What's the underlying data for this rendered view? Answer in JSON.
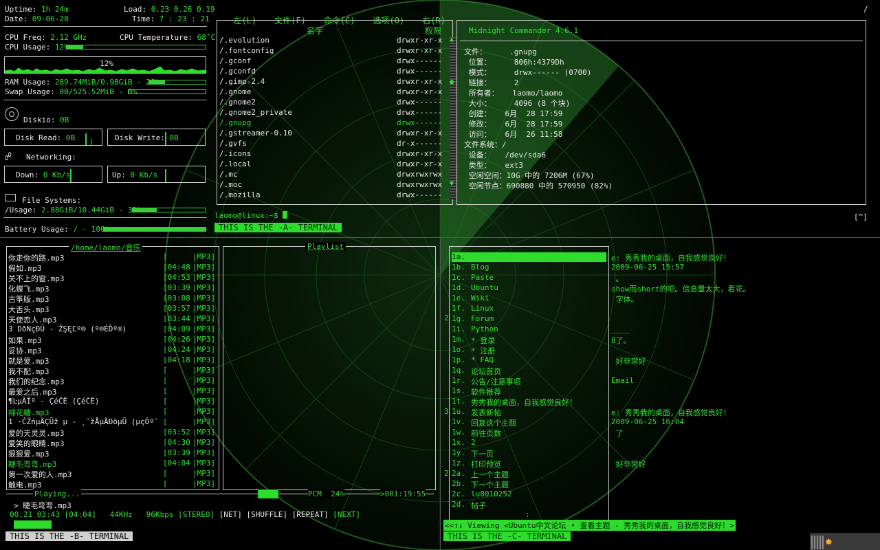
{
  "conky": {
    "uptime_label": "Uptime:",
    "uptime": "1h 24m",
    "load_label": "Load:",
    "load": "0.23 0.26 0.19",
    "date_label": "Date:",
    "date": "09-06-28",
    "time_label": "Time:",
    "time": "7 : 23 : 21",
    "cpu_freq_label": "CPU Freq:",
    "cpu_freq": "2.12 GHz",
    "cpu_temp_label": "CPU Temperature:",
    "cpu_temp": "68˚C",
    "cpu_usage_label": "CPU Usage:",
    "cpu_usage": "12%",
    "cpu_usage_value": 0.12,
    "cpu_graph_label": "12%",
    "ram_label": "RAM Usage:",
    "ram": "289.74MiB/0.98GiB - 28%",
    "ram_value": 0.28,
    "swap_label": "Swap Usage:",
    "swap": "0B/525.52MiB - 0%",
    "swap_value": 0.0,
    "diskio_label": "Diskio:",
    "diskio": "0B",
    "disk_read_label": "Disk Read:",
    "disk_read": "0B",
    "disk_write_label": "Disk Write:",
    "disk_write": "0B",
    "networking_label": "Networking:",
    "down_label": "Down:",
    "down": "0 Kb/s",
    "up_label": "Up:",
    "up": "0 Kb/s",
    "fs_label": "File Systems:",
    "usage_label": "/Usage:",
    "usage": "2.88GiB/10.44GiB - 33%",
    "usage_value": 0.33,
    "battery_label": "Battery Usage:",
    "battery": "/ - 100%",
    "battery_value": 1.0
  },
  "mc": {
    "menu": [
      "左(L)",
      "文件(F)",
      "命令(C)",
      "选项(O)",
      "右(R)"
    ],
    "path_indicator": "/",
    "left_header_name": "名字",
    "left_header_perm": "权限",
    "files": [
      {
        "name": "/.evolution",
        "perm": "drwxr-xr-x"
      },
      {
        "name": "/.fontconfig",
        "perm": "drwxr-xr-x"
      },
      {
        "name": "/.gconf",
        "perm": "drwx------"
      },
      {
        "name": "/.gconfd",
        "perm": "drwx------"
      },
      {
        "name": "/.gimp-2.4",
        "perm": "drwxr-xr-x"
      },
      {
        "name": "/.gnome",
        "perm": "drwxr-xr-x"
      },
      {
        "name": "/.gnome2",
        "perm": "drwx------"
      },
      {
        "name": "/.gnome2_private",
        "perm": "drwx------"
      },
      {
        "name": "/.gnupg",
        "perm": "drwx------"
      },
      {
        "name": "/.gstreamer-0.10",
        "perm": "drwxr-xr-x"
      },
      {
        "name": "/.gvfs",
        "perm": "dr-x------"
      },
      {
        "name": "/.icons",
        "perm": "drwxr-xr-x"
      },
      {
        "name": "/.local",
        "perm": "drwxr-xr-x"
      },
      {
        "name": "/.mc",
        "perm": "drwxrwxrwx"
      },
      {
        "name": "/.moc",
        "perm": "drwxrwxrwx"
      },
      {
        "name": "/.mozilla",
        "perm": "drwx------"
      }
    ],
    "info_title": "Midnight Commander 4.6.1",
    "info": [
      "文件：     .gnupg",
      " 位置：     806h:4379Dh",
      " 模式：     drwx------ (0700)",
      " 链接：     2",
      " 所有者：   laomo/laomo",
      " 大小：     4096 (8 个块)",
      " 创建：   6月  28 17:59",
      " 修改：   6月  28 17:59",
      " 访问：   6月  26 11:58",
      "文件系统：/",
      " 设备：   /dev/sda6",
      " 类型：   ext3",
      " 空闲空间：10G 中的 7206M (67%)",
      " 空闲节点：690880 中的 570950 (82%)"
    ],
    "prompt": "laomo@linux:~$",
    "bracket": "[^]",
    "term_label": "THIS IS THE -A- TERMINAL"
  },
  "moc": {
    "dir_title": "/home/laomo/音乐",
    "playlist_title": "Playlist",
    "songs": [
      {
        "name": "你走你的路.mp3",
        "time": "[",
        "fmt": "|MP3]"
      },
      {
        "name": "假如.mp3",
        "time": "[04:48",
        "fmt": "|MP3]"
      },
      {
        "name": "关不上的窗.mp3",
        "time": "[04:53",
        "fmt": "|MP3]"
      },
      {
        "name": "化蝶飞.mp3",
        "time": "[03:39",
        "fmt": "|MP3]"
      },
      {
        "name": "古筝版.mp3",
        "time": "[03:08",
        "fmt": "|MP3]"
      },
      {
        "name": "大舌头.mp3",
        "time": "[03:57",
        "fmt": "|MP3]"
      },
      {
        "name": "天使恋人.mp3",
        "time": "[03:44",
        "fmt": "|MP3]"
      },
      {
        "name": "3 DðNçĐÜ - ŽŞĘĽº® (º®ÉĎº®)",
        "time": "[04:09",
        "fmt": "|MP3]"
      },
      {
        "name": "如果.mp3",
        "time": "[04:26",
        "fmt": "|MP3]"
      },
      {
        "name": "妥协.mp3",
        "time": "[04:24",
        "fmt": "|MP3]"
      },
      {
        "name": "就是爱.mp3",
        "time": "[04:18",
        "fmt": "|MP3]"
      },
      {
        "name": "我不配.mp3",
        "time": "[",
        "fmt": "|MP3]"
      },
      {
        "name": "我们的纪念.mp3",
        "time": "[",
        "fmt": "|MP3]"
      },
      {
        "name": "最爱之后.mp3",
        "time": "[",
        "fmt": "|MP3]"
      },
      {
        "name": "¶ĿµÃĪº - ÇéČĒ (ÇéČĒ)",
        "time": "[",
        "fmt": "|MP3]"
      },
      {
        "name": "棉花糖.mp3",
        "time": "[",
        "fmt": "|MP3]"
      },
      {
        "name": "1 ·ĊŹńµÄÇÜž µ - ¸˘žÅµÄĐöµÜ (µçÓº˘",
        "time": "[",
        "fmt": "|MP3]"
      },
      {
        "name": "爱的天灵灵.mp3",
        "time": "[03:52",
        "fmt": "|MP3]"
      },
      {
        "name": "爱笑的眼睛.mp3",
        "time": "[04:30",
        "fmt": "|MP3]"
      },
      {
        "name": "狠狠爱.mp3",
        "time": "[03:39",
        "fmt": "|MP3]"
      },
      {
        "name": "睫毛弯弯.mp3",
        "time": "[04:04",
        "fmt": "|MP3]"
      },
      {
        "name": "第一次爱的人.mp3",
        "time": "[",
        "fmt": "|MP3]"
      },
      {
        "name": "触电.mp3",
        "time": "[",
        "fmt": "|MP3]"
      }
    ],
    "playing_label": "Playing...",
    "now_playing": "> 睫毛弯弯.mp3",
    "pcm": "PCM  24%",
    "total": ">001:19:55",
    "status_times": "00:21 03:43 [04:04]",
    "khz": "44KHz",
    "kbps": "96Kbps",
    "flags": [
      "[STEREO]",
      "[NET]",
      "[SHUFFLE]",
      "[REPEAT]",
      "[NEXT]"
    ],
    "term_label": "THIS IS THE -B- TERMINAL"
  },
  "browser": {
    "links": [
      {
        "key": "1a.",
        "label": ""
      },
      {
        "key": "1b.",
        "label": "Blog"
      },
      {
        "key": "1c.",
        "label": "Paste"
      },
      {
        "key": "1d.",
        "label": "Ubuntu"
      },
      {
        "key": "1e.",
        "label": "Wiki"
      },
      {
        "key": "1f.",
        "label": "Linux"
      },
      {
        "key": "1g.",
        "label": "Forum"
      },
      {
        "key": "1i.",
        "label": "Python"
      },
      {
        "key": "1m.",
        "label": "* 登录"
      },
      {
        "key": "1o.",
        "label": "* 注册"
      },
      {
        "key": "1p.",
        "label": "* FAQ"
      },
      {
        "key": "1q.",
        "label": "论坛首页"
      },
      {
        "key": "1r.",
        "label": "公告/注意事项"
      },
      {
        "key": "1s.",
        "label": "软件推荐"
      },
      {
        "key": "1t.",
        "label": "秀秀我的桌面，自我感觉良好！"
      },
      {
        "key": "1u.",
        "label": "发表新帖"
      },
      {
        "key": "1v.",
        "label": "回复这个主题"
      },
      {
        "key": "1w.",
        "label": "前往页数"
      },
      {
        "key": "1x.",
        "label": "2"
      },
      {
        "key": "1y.",
        "label": "下一页"
      },
      {
        "key": "1z.",
        "label": "打印预览"
      },
      {
        "key": "2a.",
        "label": "上一个主题"
      },
      {
        "key": "2b.",
        "label": "下一个主题"
      },
      {
        "key": "2c.",
        "label": "lu8010252"
      },
      {
        "key": "2d.",
        "label": "帖子"
      }
    ],
    "side_markers": [
      "2",
      "3",
      "2"
    ],
    "colon": ":",
    "content": [
      {
        "text": "e: 秀秀我的桌面，自我感觉良好！",
        "row": 0
      },
      {
        "text": "2009-06-25 15:57",
        "row": 1
      },
      {
        "text": " 。",
        "row": 2
      },
      {
        "text": "show而short的吧。信息量太大，看花。",
        "row": 3
      },
      {
        "text": " 字体。",
        "row": 4
      },
      {
        "text": "____",
        "row": 7
      },
      {
        "text": "8了。",
        "row": 8
      },
      {
        "text": " 好非常好",
        "row": 10
      },
      {
        "text": "Email",
        "row": 12
      },
      {
        "text": "e: 秀秀我的桌面，自我感觉良好！",
        "row": 15
      },
      {
        "text": "2009-06-25 16:04",
        "row": 16
      },
      {
        "text": " 了",
        "row": 17
      },
      {
        "text": " 好非常好",
        "row": 20
      }
    ],
    "status": "<<↑↓ Viewing <Ubuntu中文论坛 • 查看主题 - 秀秀我的桌面，自我感觉良好！>",
    "term_label": "THIS IS THE -C- TERMINAL"
  },
  "tray": {
    "icon": "sun-icon"
  }
}
